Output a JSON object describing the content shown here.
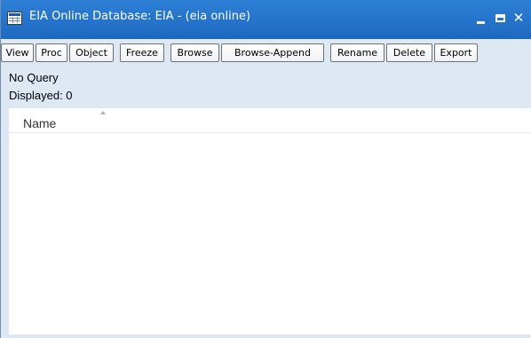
{
  "window": {
    "title": "EIA Online Database: EIA - (eia online)",
    "icon": "table-grid-icon",
    "controls": {
      "minimize": "minimize-icon",
      "maximize": "maximize-icon",
      "close": "✕"
    }
  },
  "toolbar": {
    "buttons": [
      {
        "label": "View"
      },
      {
        "label": "Proc"
      },
      {
        "label": "Object"
      },
      {
        "label": "Freeze"
      },
      {
        "label": "Browse"
      },
      {
        "label": "Browse-Append"
      },
      {
        "label": "Rename"
      },
      {
        "label": "Delete"
      },
      {
        "label": "Export"
      }
    ]
  },
  "status": {
    "query": "No Query",
    "displayed": "Displayed: 0"
  },
  "list": {
    "columns": [
      {
        "label": "Name",
        "sort_icon": "sort-ascending-icon"
      }
    ],
    "rows": []
  },
  "colors": {
    "titlebar": "#1e69c0",
    "chrome": "#dde8f3",
    "list_background": "#ffffff"
  }
}
